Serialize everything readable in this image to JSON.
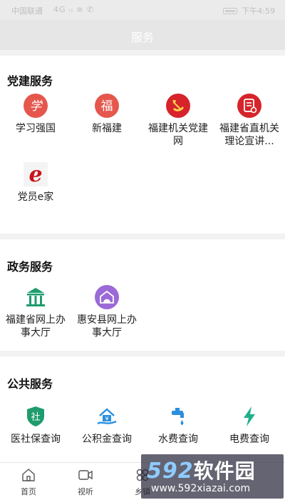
{
  "status": {
    "carrier": "中国联通",
    "signal": "4G ᵢₗ ≋ ✆",
    "time": "下午4:59"
  },
  "navbar": {
    "title": "服务"
  },
  "sections": [
    {
      "title": "党建服务",
      "items": [
        {
          "label": "学习强国",
          "icon": "study-icon",
          "color": "#e5574d"
        },
        {
          "label": "新福建",
          "icon": "fu-icon",
          "color": "#e5574d"
        },
        {
          "label": "福建机关党建网",
          "icon": "party-icon",
          "color": "#d6242a"
        },
        {
          "label": "福建省直机关理论宣讲...",
          "icon": "document-icon",
          "color": "#d6242a"
        },
        {
          "label": "党员e家",
          "icon": "e-home-icon",
          "color": "#c8141c"
        }
      ]
    },
    {
      "title": "政务服务",
      "items": [
        {
          "label": "福建省网上办事大厅",
          "icon": "government-building-icon",
          "color": "#1f9c6e"
        },
        {
          "label": "惠安县网上办事大厅",
          "icon": "hall-icon",
          "color": "#9b6ad6"
        }
      ]
    },
    {
      "title": "公共服务",
      "items": [
        {
          "label": "医社保查询",
          "icon": "social-security-icon",
          "color": "#1f9c6e"
        },
        {
          "label": "公积金查询",
          "icon": "housing-fund-icon",
          "color": "#2a8fe0"
        },
        {
          "label": "水费查询",
          "icon": "water-tap-icon",
          "color": "#2a8fe0"
        },
        {
          "label": "电费查询",
          "icon": "lightning-icon",
          "color": "#1fb08a"
        }
      ]
    }
  ],
  "tabs": [
    {
      "label": "首页",
      "icon": "home-icon"
    },
    {
      "label": "视听",
      "icon": "video-icon"
    },
    {
      "label": "乡镇",
      "icon": "grid-icon"
    }
  ],
  "watermark": {
    "logo_num": "592",
    "logo_text": "软件园",
    "url": "www.592xiazai.com"
  }
}
